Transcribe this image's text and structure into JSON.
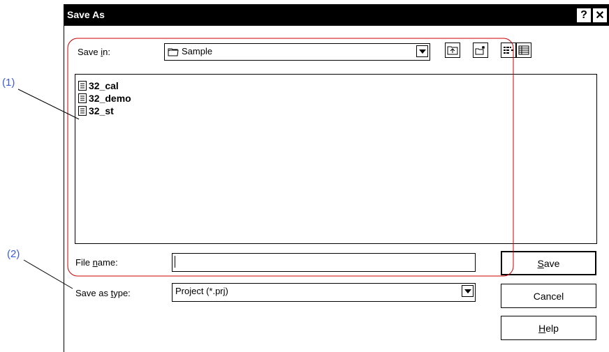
{
  "dialog": {
    "title": "Save As",
    "help_glyph": "?",
    "close_glyph": "✕"
  },
  "save_in": {
    "label_pre": "Save ",
    "label_key": "i",
    "label_post": "n:",
    "value": "Sample",
    "icon": "folder-icon"
  },
  "toolbar": {
    "up_icon": "up-one-level-icon",
    "new_folder_icon": "new-folder-icon",
    "list_icon": "list-view-icon",
    "details_icon": "details-view-icon"
  },
  "files": [
    {
      "name": "32_cal"
    },
    {
      "name": "32_demo"
    },
    {
      "name": "32_st"
    }
  ],
  "file_name": {
    "label_pre": "File ",
    "label_key": "n",
    "label_post": "ame:",
    "value": ""
  },
  "save_as_type": {
    "label_pre": "Save as ",
    "label_key": "t",
    "label_post": "ype:",
    "value": "Project (*.prj)"
  },
  "buttons": {
    "save_key": "S",
    "save_rest": "ave",
    "cancel": "Cancel",
    "help_key": "H",
    "help_rest": "elp"
  },
  "callouts": {
    "one": "(1)",
    "two": "(2)"
  },
  "colors": {
    "callout_text": "#3a5bd9",
    "highlight_border": "#cc0000"
  }
}
